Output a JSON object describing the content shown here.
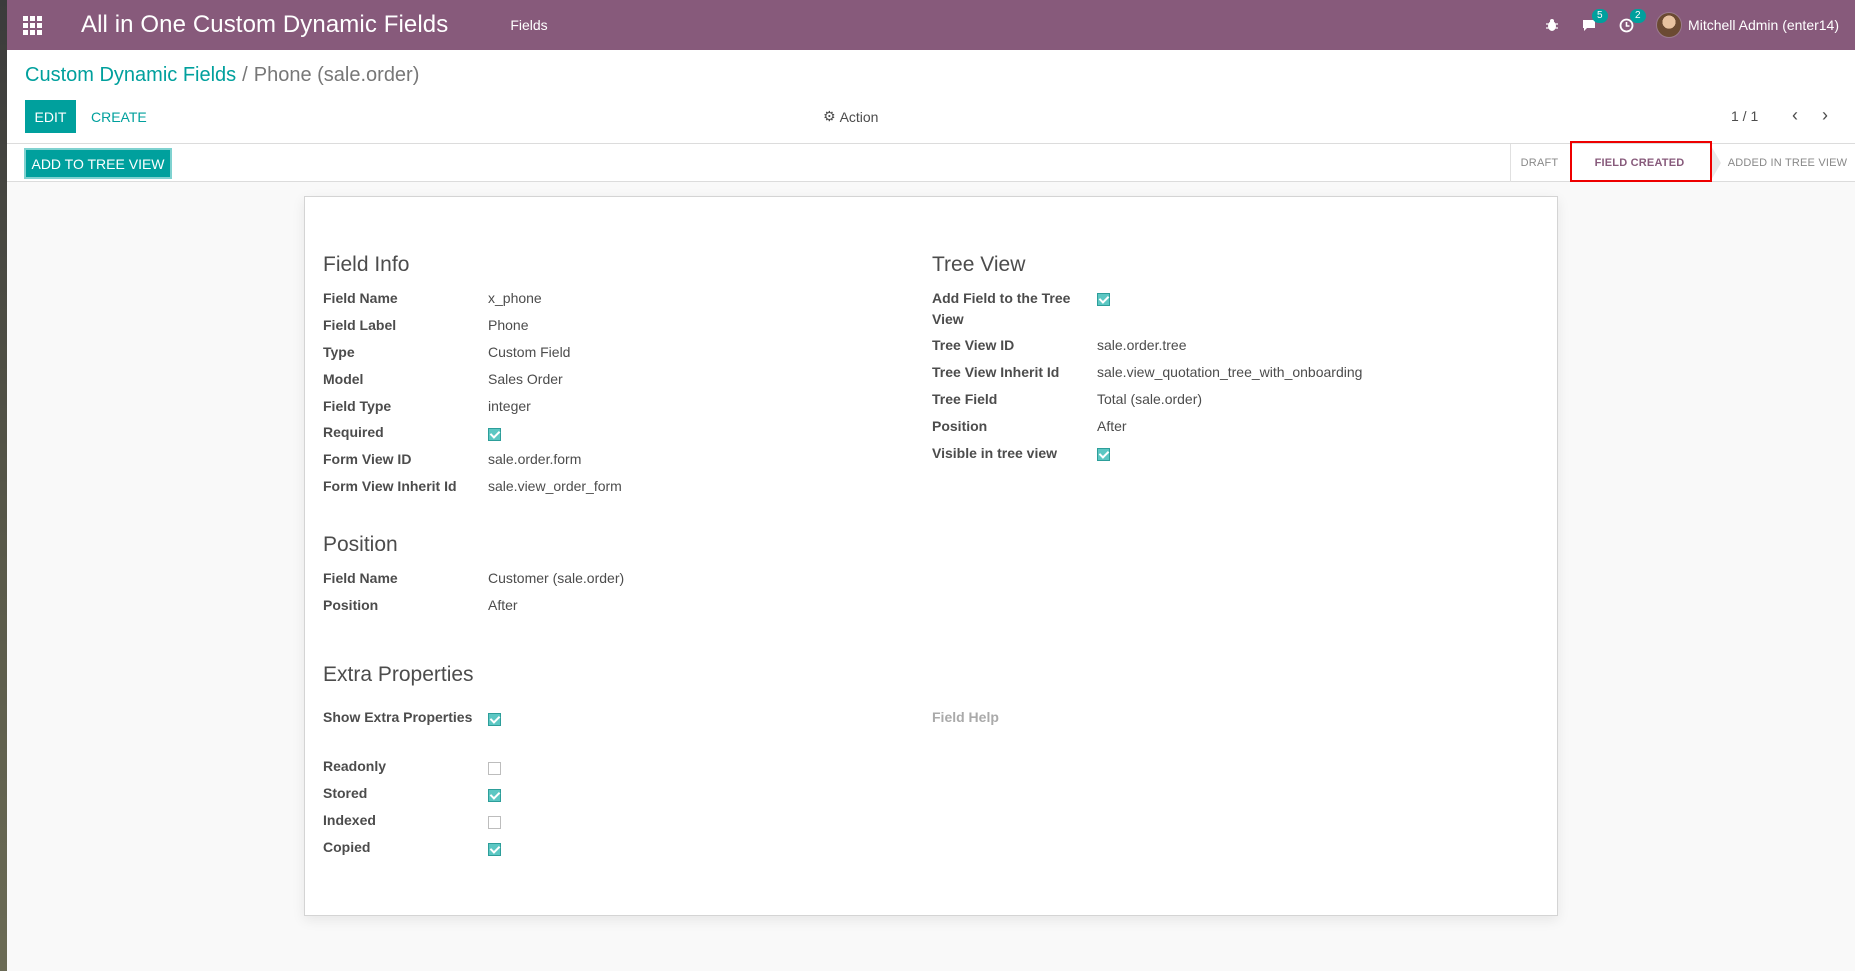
{
  "navbar": {
    "app_title": "All in One Custom Dynamic Fields",
    "menu_fields": "Fields",
    "bug_icon": "bug-icon",
    "chat_badge": "5",
    "activity_badge": "2",
    "user_name": "Mitchell Admin (enter14)",
    "color": "#875a7b"
  },
  "breadcrumb": {
    "parent": "Custom Dynamic Fields",
    "separator": "/",
    "current": "Phone (sale.order)"
  },
  "control": {
    "edit_label": "EDIT",
    "create_label": "CREATE",
    "action_label": "Action",
    "pager": "1 / 1",
    "pager_prev": "‹",
    "pager_next": "›"
  },
  "statusbar": {
    "add_tree_label": "ADD TO TREE VIEW",
    "stages": [
      "DRAFT",
      "FIELD CREATED",
      "ADDED IN TREE VIEW"
    ],
    "active_stage": "FIELD CREATED"
  },
  "field_info": {
    "title": "Field Info",
    "rows": [
      {
        "label": "Field Name",
        "value": "x_phone"
      },
      {
        "label": "Field Label",
        "value": "Phone"
      },
      {
        "label": "Type",
        "value": "Custom Field"
      },
      {
        "label": "Model",
        "value": "Sales Order"
      },
      {
        "label": "Field Type",
        "value": "integer"
      },
      {
        "label": "Required",
        "checked": true
      },
      {
        "label": "Form View ID",
        "value": "sale.order.form"
      },
      {
        "label": "Form View Inherit Id",
        "value": "sale.view_order_form"
      }
    ]
  },
  "tree_view": {
    "title": "Tree View",
    "rows": [
      {
        "label": "Add Field to the Tree View",
        "checked": true
      },
      {
        "label": "Tree View ID",
        "value": "sale.order.tree"
      },
      {
        "label": "Tree View Inherit Id",
        "value": "sale.view_quotation_tree_with_onboarding"
      },
      {
        "label": "Tree Field",
        "value": "Total (sale.order)"
      },
      {
        "label": "Position",
        "value": "After"
      },
      {
        "label": "Visible in tree view",
        "checked": true
      }
    ]
  },
  "position": {
    "title": "Position",
    "rows": [
      {
        "label": "Field Name",
        "value": "Customer (sale.order)"
      },
      {
        "label": "Position",
        "value": "After"
      }
    ]
  },
  "extra": {
    "title": "Extra Properties",
    "show_label": "Show Extra Properties",
    "show_checked": true,
    "field_help_label": "Field Help",
    "rows": [
      {
        "label": "Readonly",
        "checked": false
      },
      {
        "label": "Stored",
        "checked": true
      },
      {
        "label": "Indexed",
        "checked": false
      },
      {
        "label": "Copied",
        "checked": true
      }
    ]
  }
}
